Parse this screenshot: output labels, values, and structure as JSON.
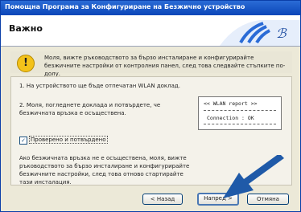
{
  "window": {
    "title": "Помощна Програма за Конфигуриране на Безжично устройство"
  },
  "header": {
    "title": "Важно"
  },
  "warning": {
    "icon": "exclamation-warning-icon",
    "text": "Моля, вижте ръководството за бързо инсталиране и конфигурирайте безжичните настройки от контролния панел, след това следвайте стъпките по-долу."
  },
  "steps": {
    "step1": "1. На устройството ще бъде отпечатан WLAN доклад.",
    "step2": "2. Моля, погледнете доклада и потвърдете, че безжичната връзка е осъществена.",
    "checkbox_label": "Проверено и потвърдено",
    "checkbox_checked": true,
    "note": "Ако безжичната връзка не е осъществена, моля, вижте ръководството за бързо инсталиране и конфигурирайте безжичните настройки, след това отново стартирайте тази инсталация."
  },
  "report": {
    "heading": "<< WLAN report >>",
    "status_line": "Connection : OK"
  },
  "buttons": {
    "back": "< Назад",
    "next": "Напред >",
    "cancel": "Отмяна"
  },
  "colors": {
    "titlebar": "#0b46b8",
    "arrow": "#1f5aa8",
    "logo_ring": "#2a6bd6"
  }
}
